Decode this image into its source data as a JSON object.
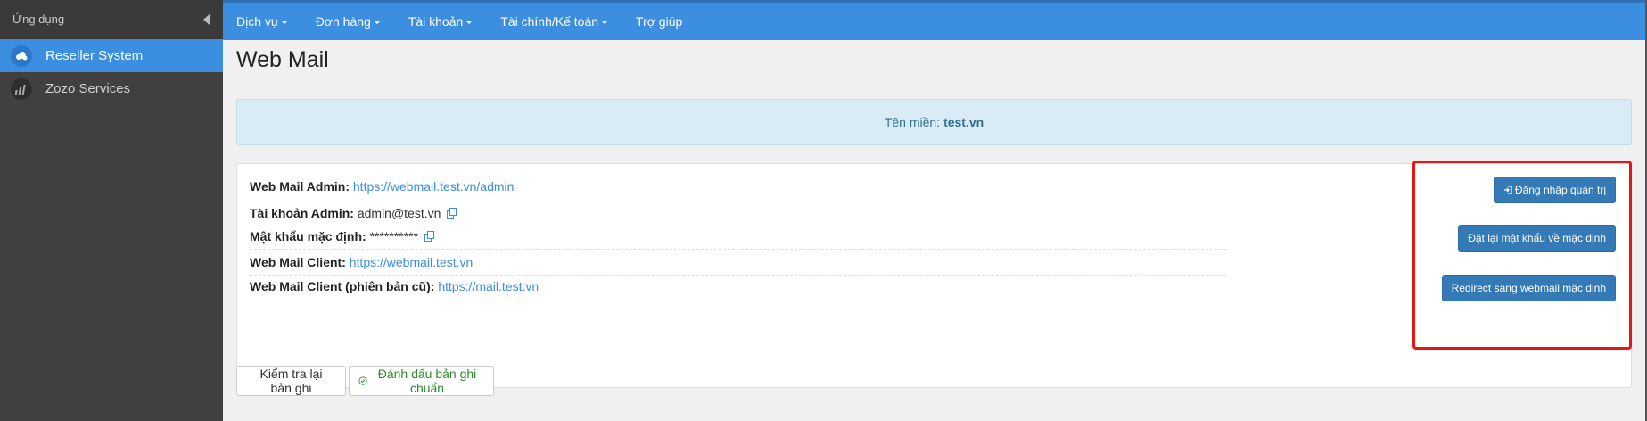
{
  "sidebar": {
    "title": "Ứng dụng",
    "items": [
      {
        "label": "Reseller System",
        "icon": "cloud-icon",
        "active": true
      },
      {
        "label": "Zozo Services",
        "icon": "bars-icon",
        "active": false
      }
    ]
  },
  "topnav": {
    "items": [
      {
        "label": "Dịch vụ",
        "dropdown": true
      },
      {
        "label": "Đơn hàng",
        "dropdown": true
      },
      {
        "label": "Tài khoản",
        "dropdown": true
      },
      {
        "label": "Tài chính/Kế toán",
        "dropdown": true
      },
      {
        "label": "Trợ giúp",
        "dropdown": false
      }
    ]
  },
  "page": {
    "title": "Web Mail",
    "domain_label": "Tên miền:",
    "domain_value": "test.vn"
  },
  "info": {
    "admin_label": "Web Mail Admin:",
    "admin_url": "https://webmail.test.vn/admin",
    "account_label": "Tài khoản Admin:",
    "account_value": "admin@test.vn",
    "password_label": "Mật khẩu mặc định:",
    "password_value": "**********",
    "client_label": "Web Mail Client:",
    "client_url": "https://webmail.test.vn",
    "client_old_label": "Web Mail Client (phiên bản cũ):",
    "client_old_url": "https://mail.test.vn"
  },
  "actions": {
    "login_admin": "Đăng nhập quản trị",
    "reset_password": "Đặt lại mật khẩu về mặc định",
    "redirect_default": "Redirect sang webmail mặc định"
  },
  "footer_buttons": {
    "recheck": "Kiểm tra lại bản ghi",
    "mark_standard": "Đánh dấu bản ghi chuẩn"
  },
  "colors": {
    "nav_blue": "#3b8ee0",
    "primary_button": "#337ab7",
    "highlight_red": "#e51616",
    "success_green": "#2e8a2e"
  }
}
